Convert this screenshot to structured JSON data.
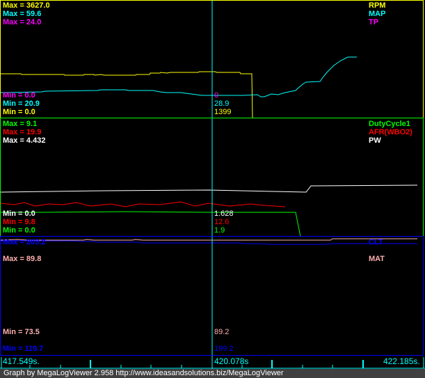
{
  "panels": [
    {
      "channels": [
        {
          "name": "RPM",
          "max": "Max = 3627.0",
          "min": "Min = 0.0",
          "cursor": "1399",
          "color": "#ffff00"
        },
        {
          "name": "MAP",
          "max": "Max = 59.6",
          "min": "Min = 20.9",
          "cursor": "28.9",
          "color": "#00ffff"
        },
        {
          "name": "TP",
          "max": "Max = 24.0",
          "min": "Min = 0.0",
          "cursor": "0",
          "color": "#ff00ff"
        }
      ]
    },
    {
      "channels": [
        {
          "name": "DutyCycle1",
          "max": "Max = 9.1",
          "min": "Min = 0.0",
          "cursor": "1.9",
          "color": "#00ff00"
        },
        {
          "name": "AFR(WBO2)",
          "max": "Max = 19.9",
          "min": "Min = 9.8",
          "cursor": "12.6",
          "color": "#ff0000"
        },
        {
          "name": "PW",
          "max": "Max = 4.432",
          "min": "Min = 0.0",
          "cursor": "1.628",
          "color": "#ffffff"
        }
      ]
    },
    {
      "channels": [
        {
          "name": "CLT",
          "max": "Max = 203.2",
          "min": "Min = 119.7",
          "cursor": "199.2",
          "color": "#0000ff"
        },
        {
          "name": "MAT",
          "max": "Max = 89.8",
          "min": "Min = 73.5",
          "cursor": "89.2",
          "color": "#ffafaf"
        }
      ]
    }
  ],
  "time_axis": {
    "start": "417.549s.",
    "cursor": "420.078s",
    "end": "422.185s."
  },
  "footer": "Graph by MegaLogViewer 2.958 http://www.ideasandsolutions.biz/MegaLogViewer"
}
